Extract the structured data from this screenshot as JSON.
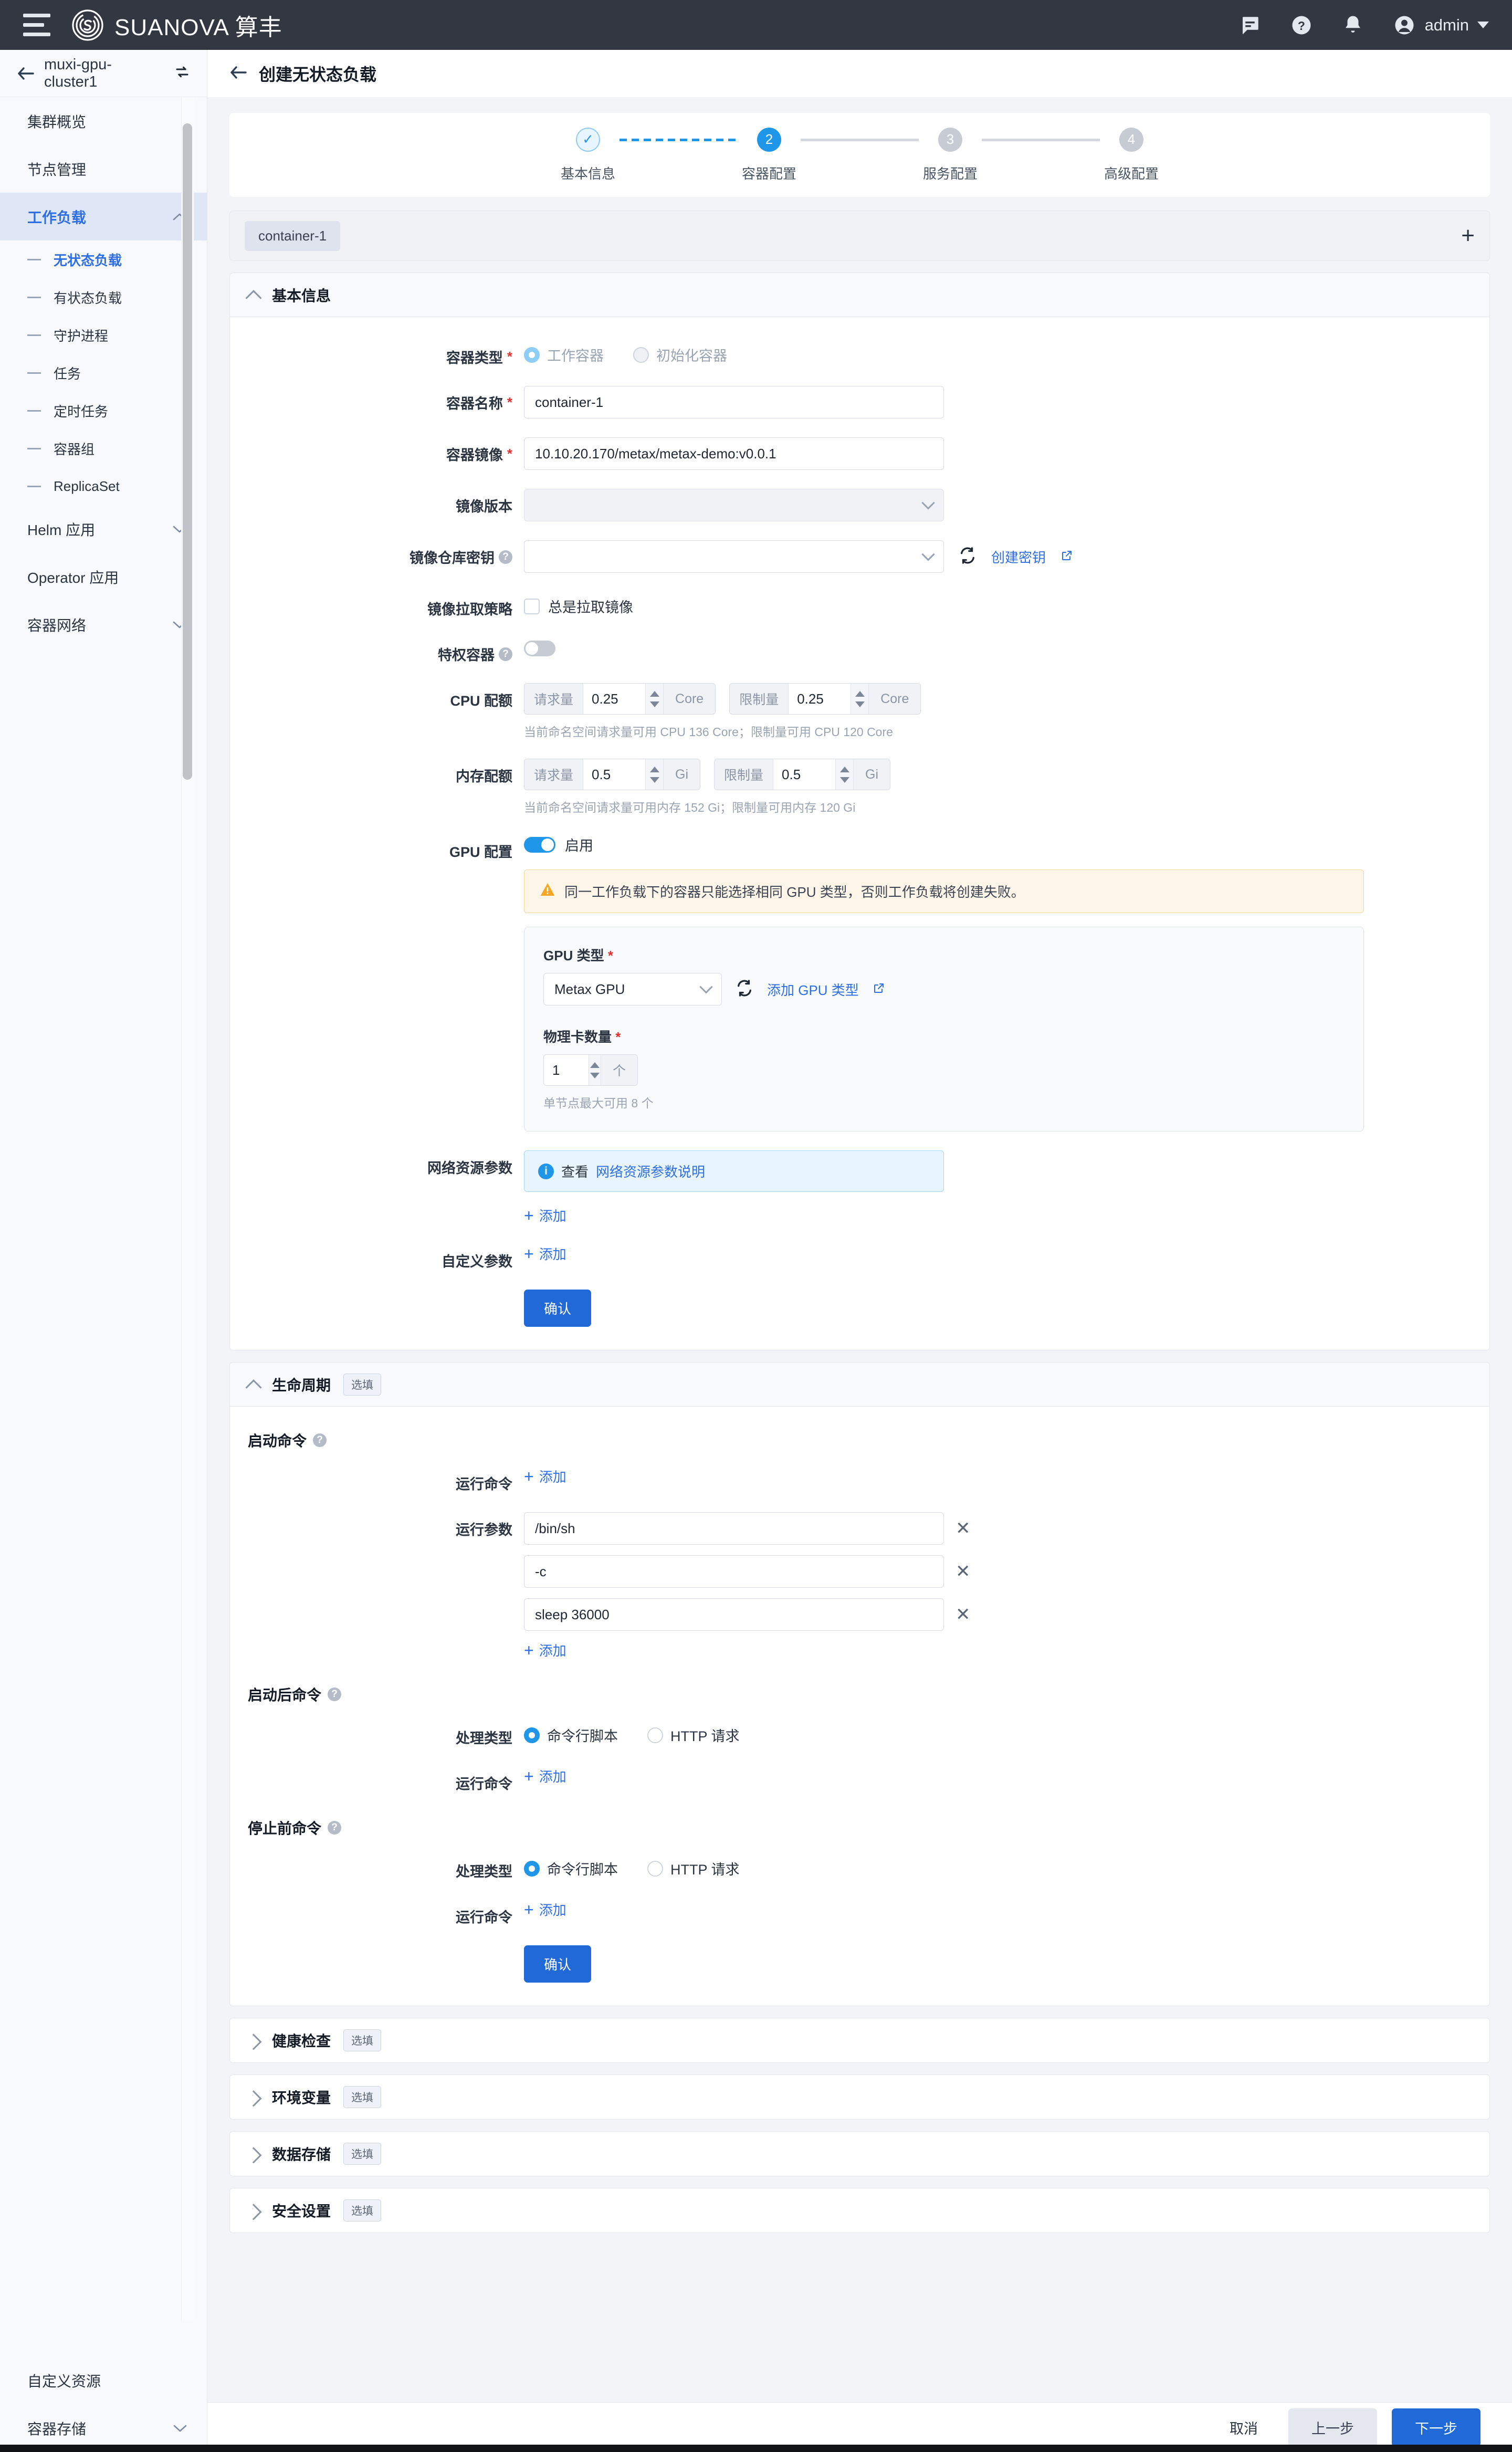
{
  "topbar": {
    "brand": "SUANOVA 算丰",
    "user": "admin",
    "icons": [
      "chat-icon",
      "help-icon",
      "bell-icon",
      "avatar-icon"
    ]
  },
  "sidebar": {
    "cluster": "muxi-gpu-cluster1",
    "items": [
      {
        "label": "集群概览",
        "type": "item",
        "active": false
      },
      {
        "label": "节点管理",
        "type": "item",
        "active": false
      },
      {
        "label": "工作负载",
        "type": "group",
        "active": true,
        "expanded": true
      },
      {
        "label": "无状态负载",
        "type": "sub",
        "active": true
      },
      {
        "label": "有状态负载",
        "type": "sub",
        "active": false
      },
      {
        "label": "守护进程",
        "type": "sub",
        "active": false
      },
      {
        "label": "任务",
        "type": "sub",
        "active": false
      },
      {
        "label": "定时任务",
        "type": "sub",
        "active": false
      },
      {
        "label": "容器组",
        "type": "sub",
        "active": false
      },
      {
        "label": "ReplicaSet",
        "type": "sub",
        "active": false
      },
      {
        "label": "Helm 应用",
        "type": "group",
        "active": false,
        "expanded": false
      },
      {
        "label": "Operator 应用",
        "type": "item",
        "active": false
      },
      {
        "label": "容器网络",
        "type": "group",
        "active": false,
        "expanded": false
      }
    ],
    "bottom_items": [
      {
        "label": "自定义资源",
        "type": "item"
      },
      {
        "label": "容器存储",
        "type": "group"
      }
    ]
  },
  "page": {
    "title": "创建无状态负载"
  },
  "stepper": {
    "steps": [
      {
        "num": "✓",
        "label": "基本信息",
        "state": "done"
      },
      {
        "num": "2",
        "label": "容器配置",
        "state": "current"
      },
      {
        "num": "3",
        "label": "服务配置",
        "state": "todo"
      },
      {
        "num": "4",
        "label": "高级配置",
        "state": "todo"
      }
    ]
  },
  "container_tabs": {
    "tabs": [
      "container-1"
    ],
    "add_label": "+"
  },
  "basic": {
    "title": "基本信息",
    "container_type_label": "容器类型",
    "type_work": "工作容器",
    "type_init": "初始化容器",
    "name_label": "容器名称",
    "name_value": "container-1",
    "image_label": "容器镜像",
    "image_value": "10.10.20.170/metax/metax-demo:v0.0.1",
    "version_label": "镜像版本",
    "version_value": "",
    "secret_label": "镜像仓库密钥",
    "secret_value": "",
    "create_secret_link": "创建密钥",
    "pull_policy_label": "镜像拉取策略",
    "pull_always": "总是拉取镜像",
    "privileged_label": "特权容器",
    "cpu_label": "CPU 配额",
    "cpu_request_prefix": "请求量",
    "cpu_request_value": "0.25",
    "cpu_request_unit": "Core",
    "cpu_limit_prefix": "限制量",
    "cpu_limit_value": "0.25",
    "cpu_limit_unit": "Core",
    "cpu_hint": "当前命名空间请求量可用 CPU 136 Core；限制量可用 CPU 120 Core",
    "mem_label": "内存配额",
    "mem_request_prefix": "请求量",
    "mem_request_value": "0.5",
    "mem_request_unit": "Gi",
    "mem_limit_prefix": "限制量",
    "mem_limit_value": "0.5",
    "mem_limit_unit": "Gi",
    "mem_hint": "当前命名空间请求量可用内存 152 Gi；限制量可用内存 120 Gi",
    "gpu_label": "GPU 配置",
    "gpu_enabled_text": "启用",
    "gpu_warning": "同一工作负载下的容器只能选择相同 GPU 类型，否则工作负载将创建失败。",
    "gpu_type_label": "GPU 类型",
    "gpu_type_value": "Metax GPU",
    "gpu_add_type_link": "添加 GPU 类型",
    "gpu_card_count_label": "物理卡数量",
    "gpu_card_count_value": "1",
    "gpu_card_count_unit": "个",
    "gpu_card_hint": "单节点最大可用 8 个",
    "net_label": "网络资源参数",
    "net_info_prefix": "查看",
    "net_info_link": "网络资源参数说明",
    "net_add": "添加",
    "custom_label": "自定义参数",
    "custom_add": "添加",
    "confirm": "确认"
  },
  "lifecycle": {
    "title": "生命周期",
    "optional": "选填",
    "start_cmd_heading": "启动命令",
    "run_command_label": "运行命令",
    "run_command_add": "添加",
    "run_args_label": "运行参数",
    "run_args": [
      "/bin/sh",
      "-c",
      "sleep 36000"
    ],
    "run_args_add": "添加",
    "post_start_heading": "启动后命令",
    "pre_stop_heading": "停止前命令",
    "handler_label": "处理类型",
    "handler_script": "命令行脚本",
    "handler_http": "HTTP 请求",
    "confirm": "确认"
  },
  "collapsed_sections": [
    {
      "title": "健康检查",
      "optional": "选填"
    },
    {
      "title": "环境变量",
      "optional": "选填"
    },
    {
      "title": "数据存储",
      "optional": "选填"
    },
    {
      "title": "安全设置",
      "optional": "选填"
    }
  ],
  "footer": {
    "cancel": "取消",
    "prev": "上一步",
    "next": "下一步"
  },
  "colors": {
    "primary": "#2269d8",
    "accent": "#1f96e8",
    "link": "#2f6fe4",
    "topbar": "#323741",
    "warning_bg": "#fdf6e8",
    "warning_border": "#f3d79b",
    "info_bg": "#e9f5fe",
    "required": "#e03131"
  }
}
